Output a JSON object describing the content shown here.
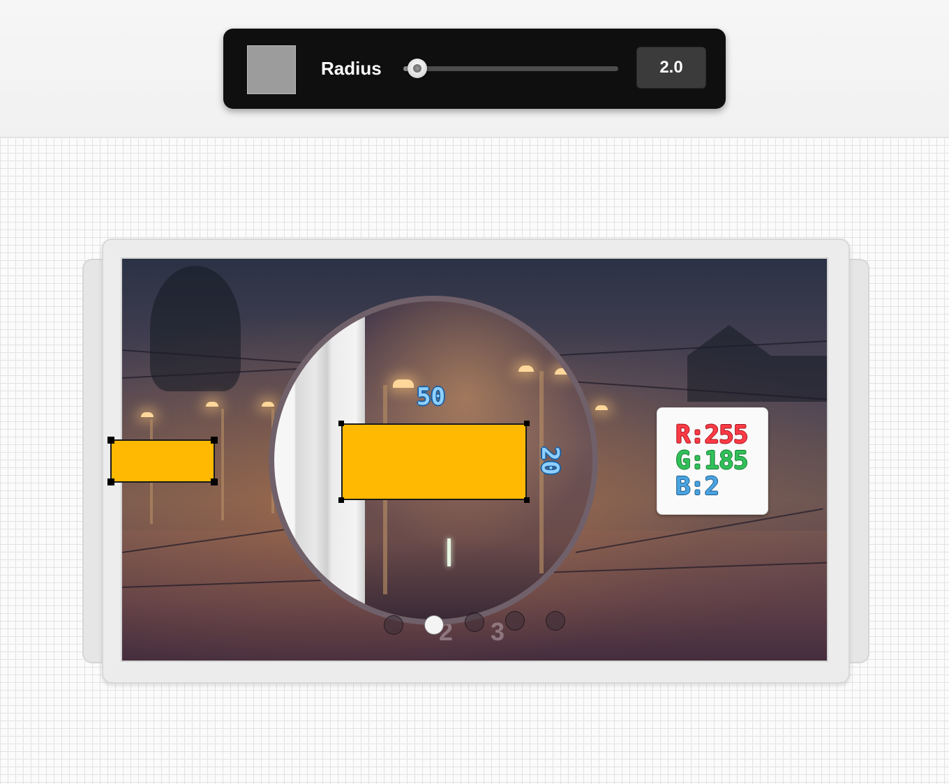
{
  "toolbar": {
    "swatch_color": "#9c9c9c",
    "radius_label": "Radius",
    "radius_value": "2.0",
    "slider_min": 0,
    "slider_max": 100,
    "slider_position_percent": 7
  },
  "canvas": {
    "dimension_width": "50",
    "dimension_height": "20",
    "shape_color": "#ffb902",
    "rgb": {
      "r": "R:255",
      "g": "G:185",
      "b": "B:2"
    },
    "pagination": {
      "page_count": 5,
      "active_index": 1,
      "sign_numbers": [
        "2",
        "3"
      ]
    }
  }
}
